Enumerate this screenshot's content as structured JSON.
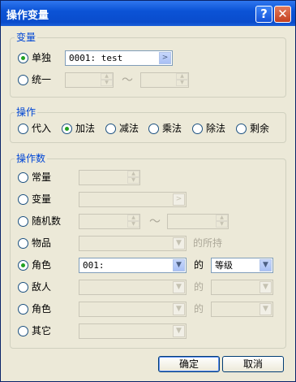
{
  "window": {
    "title": "操作变量",
    "help_icon": "?",
    "close_icon": "✕"
  },
  "variable_group": {
    "title": "变量",
    "single_label": "单独",
    "single_value": "0001: test",
    "single_checked": true,
    "unify_label": "统一",
    "range_separator": "～"
  },
  "operation_group": {
    "title": "操作",
    "options": [
      {
        "label": "代入",
        "checked": false
      },
      {
        "label": "加法",
        "checked": true
      },
      {
        "label": "减法",
        "checked": false
      },
      {
        "label": "乘法",
        "checked": false
      },
      {
        "label": "除法",
        "checked": false
      },
      {
        "label": "剩余",
        "checked": false
      }
    ]
  },
  "operand_group": {
    "title": "操作数",
    "constant_label": "常量",
    "variable_label": "变量",
    "random_label": "随机数",
    "random_separator": "～",
    "item_label": "物品",
    "item_suffix": "的所持",
    "actor_label": "角色",
    "actor_checked": true,
    "actor_value": "001:",
    "actor_of": "的",
    "actor_attr": "等级",
    "enemy_label": "敌人",
    "enemy_of": "的",
    "character_label": "角色",
    "character_of": "的",
    "other_label": "其它"
  },
  "buttons": {
    "ok": "确定",
    "cancel": "取消"
  }
}
